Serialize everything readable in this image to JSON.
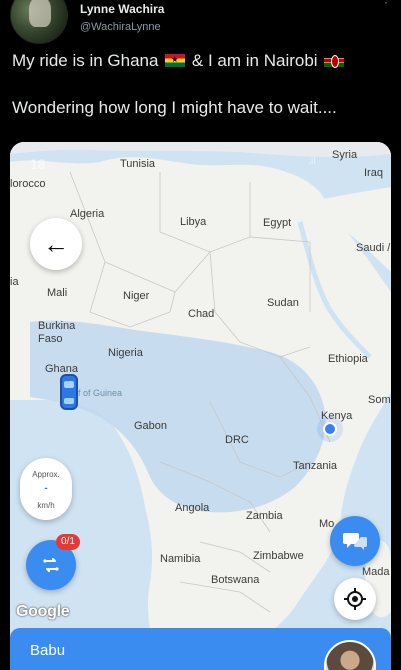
{
  "tweet": {
    "author_name": "Lynne Wachira",
    "author_handle": "@WachiraLynne",
    "line1_a": "My ride is in Ghana",
    "line1_b": "& I am in Nairobi",
    "line2": "Wondering how long I might have to wait...."
  },
  "icons": {
    "more": "more-vertical-icon",
    "flag1": "ghana-flag-icon",
    "flag2": "kenya-flag-icon",
    "back": "arrow-left-icon",
    "route": "route-icon",
    "chat": "chat-icon",
    "locate": "locate-icon",
    "car": "car-icon"
  },
  "map": {
    "status_time": "18",
    "labels": {
      "tunisia": "Tunisia",
      "syria": "Syria",
      "iraq": "Iraq",
      "morocco": "lorocco",
      "algeria": "Algeria",
      "libya": "Libya",
      "egypt": "Egypt",
      "saudi": "Saudi /",
      "ia": "ia",
      "mali": "Mali",
      "niger": "Niger",
      "chad": "Chad",
      "sudan": "Sudan",
      "burkina": "Burkina\nFaso",
      "nigeria": "Nigeria",
      "ethiopia": "Ethiopia",
      "ghana": "Ghana",
      "guinea": "f of Guinea",
      "somalia": "Som",
      "gabon": "Gabon",
      "kenya": "Kenya",
      "drc": "DRC",
      "tanzania": "Tanzania",
      "angola": "Angola",
      "zambia": "Zambia",
      "mozambique": "Mo    ue",
      "namibia": "Namibia",
      "zimbabwe": "Zimbabwe",
      "madagascar": "Mada",
      "botswana": "Botswana"
    },
    "eta": {
      "approx": "Approx.",
      "value": "-",
      "unit": "km/h"
    },
    "route_badge": "0/1",
    "google": "Google",
    "driver_name": "Babu"
  },
  "colors": {
    "primary": "#3b8cf0",
    "land": "#f2f2ef",
    "ocean": "#cfe3f3",
    "forest": "#bfd8ee",
    "badge": "#e53935"
  }
}
